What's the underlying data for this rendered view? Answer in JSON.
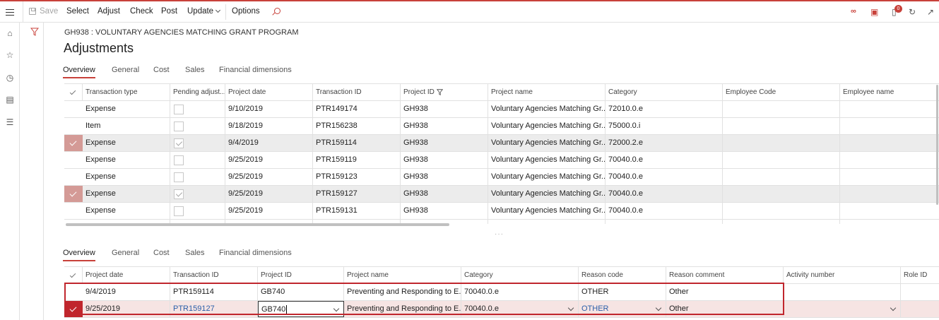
{
  "toolbar": {
    "save": "Save",
    "select": "Select",
    "adjust": "Adjust",
    "check": "Check",
    "post": "Post",
    "update": "Update",
    "options": "Options",
    "notification_count": "0"
  },
  "header": {
    "breadcrumb": "GH938 : VOLUNTARY AGENCIES MATCHING GRANT PROGRAM",
    "title": "Adjustments"
  },
  "top_tabs": [
    "Overview",
    "General",
    "Cost",
    "Sales",
    "Financial dimensions"
  ],
  "bottom_tabs": [
    "Overview",
    "General",
    "Cost",
    "Sales",
    "Financial dimensions"
  ],
  "top_grid": {
    "columns": [
      "Transaction type",
      "Pending adjust...",
      "Project date",
      "Transaction ID",
      "Project ID",
      "Project name",
      "Category",
      "Employee Code",
      "Employee name"
    ],
    "rows": [
      {
        "type": "Expense",
        "pending": false,
        "date": "9/10/2019",
        "txn": "PTR149174",
        "project": "GH938",
        "name": "Voluntary Agencies Matching Gr...",
        "category": "72010.0.e",
        "marked": false
      },
      {
        "type": "Item",
        "pending": false,
        "date": "9/18/2019",
        "txn": "PTR156238",
        "project": "GH938",
        "name": "Voluntary Agencies Matching Gr...",
        "category": "75000.0.i",
        "marked": false
      },
      {
        "type": "Expense",
        "pending": true,
        "date": "9/4/2019",
        "txn": "PTR159114",
        "project": "GH938",
        "name": "Voluntary Agencies Matching Gr...",
        "category": "72000.2.e",
        "marked": true
      },
      {
        "type": "Expense",
        "pending": false,
        "date": "9/25/2019",
        "txn": "PTR159119",
        "project": "GH938",
        "name": "Voluntary Agencies Matching Gr...",
        "category": "70040.0.e",
        "marked": false
      },
      {
        "type": "Expense",
        "pending": false,
        "date": "9/25/2019",
        "txn": "PTR159123",
        "project": "GH938",
        "name": "Voluntary Agencies Matching Gr...",
        "category": "70040.0.e",
        "marked": false
      },
      {
        "type": "Expense",
        "pending": true,
        "date": "9/25/2019",
        "txn": "PTR159127",
        "project": "GH938",
        "name": "Voluntary Agencies Matching Gr...",
        "category": "70040.0.e",
        "marked": true
      },
      {
        "type": "Expense",
        "pending": false,
        "date": "9/25/2019",
        "txn": "PTR159131",
        "project": "GH938",
        "name": "Voluntary Agencies Matching Gr...",
        "category": "70040.0.e",
        "marked": false
      }
    ]
  },
  "bottom_grid": {
    "columns": [
      "Project date",
      "Transaction ID",
      "Project ID",
      "Project name",
      "Category",
      "Reason code",
      "Reason comment",
      "Activity number",
      "Role ID"
    ],
    "rows": [
      {
        "date": "9/4/2019",
        "txn": "PTR159114",
        "project": "GB740",
        "name": "Preventing and Responding to E...",
        "category": "70040.0.e",
        "reason": "OTHER",
        "comment": "Other"
      },
      {
        "date": "9/25/2019",
        "txn": "PTR159127",
        "project": "GB740",
        "name": "Preventing and Responding to E...",
        "category": "70040.0.e",
        "reason": "OTHER",
        "comment": "Other"
      }
    ]
  },
  "colors": {
    "accent": "#c8413a",
    "highlight_border": "#c0262d",
    "link": "#2b5faa"
  }
}
